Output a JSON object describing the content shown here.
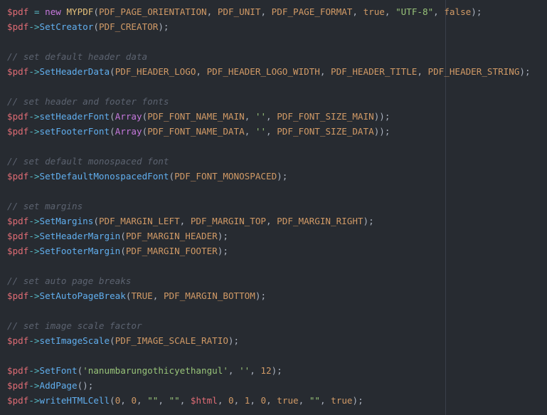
{
  "editor": {
    "lines": [
      [
        [
          "var",
          "$pdf"
        ],
        [
          "punc",
          " "
        ],
        [
          "op",
          "="
        ],
        [
          "punc",
          " "
        ],
        [
          "kw",
          "new"
        ],
        [
          "punc",
          " "
        ],
        [
          "cls",
          "MYPDF"
        ],
        [
          "punc",
          "("
        ],
        [
          "const",
          "PDF_PAGE_ORIENTATION"
        ],
        [
          "punc",
          ", "
        ],
        [
          "const",
          "PDF_UNIT"
        ],
        [
          "punc",
          ", "
        ],
        [
          "const",
          "PDF_PAGE_FORMAT"
        ],
        [
          "punc",
          ", "
        ],
        [
          "const",
          "true"
        ],
        [
          "punc",
          ", "
        ],
        [
          "str",
          "\"UTF-8\""
        ],
        [
          "punc",
          ", "
        ],
        [
          "const",
          "false"
        ],
        [
          "punc",
          ");"
        ]
      ],
      [
        [
          "var",
          "$pdf"
        ],
        [
          "op",
          "->"
        ],
        [
          "fn",
          "SetCreator"
        ],
        [
          "punc",
          "("
        ],
        [
          "const",
          "PDF_CREATOR"
        ],
        [
          "punc",
          ");"
        ]
      ],
      [],
      [
        [
          "cmt",
          "// set default header data"
        ]
      ],
      [
        [
          "var",
          "$pdf"
        ],
        [
          "op",
          "->"
        ],
        [
          "fn",
          "SetHeaderData"
        ],
        [
          "punc",
          "("
        ],
        [
          "const",
          "PDF_HEADER_LOGO"
        ],
        [
          "punc",
          ", "
        ],
        [
          "const",
          "PDF_HEADER_LOGO_WIDTH"
        ],
        [
          "punc",
          ", "
        ],
        [
          "const",
          "PDF_HEADER_TITLE"
        ],
        [
          "punc",
          ", "
        ],
        [
          "const",
          "PDF_HEADER_STRING"
        ],
        [
          "punc",
          ");"
        ]
      ],
      [],
      [
        [
          "cmt",
          "// set header and footer fonts"
        ]
      ],
      [
        [
          "var",
          "$pdf"
        ],
        [
          "op",
          "->"
        ],
        [
          "fn",
          "setHeaderFont"
        ],
        [
          "punc",
          "("
        ],
        [
          "kw",
          "Array"
        ],
        [
          "punc",
          "("
        ],
        [
          "const",
          "PDF_FONT_NAME_MAIN"
        ],
        [
          "punc",
          ", "
        ],
        [
          "str",
          "''"
        ],
        [
          "punc",
          ", "
        ],
        [
          "const",
          "PDF_FONT_SIZE_MAIN"
        ],
        [
          "punc",
          "));"
        ]
      ],
      [
        [
          "var",
          "$pdf"
        ],
        [
          "op",
          "->"
        ],
        [
          "fn",
          "setFooterFont"
        ],
        [
          "punc",
          "("
        ],
        [
          "kw",
          "Array"
        ],
        [
          "punc",
          "("
        ],
        [
          "const",
          "PDF_FONT_NAME_DATA"
        ],
        [
          "punc",
          ", "
        ],
        [
          "str",
          "''"
        ],
        [
          "punc",
          ", "
        ],
        [
          "const",
          "PDF_FONT_SIZE_DATA"
        ],
        [
          "punc",
          "));"
        ]
      ],
      [],
      [
        [
          "cmt",
          "// set default monospaced font"
        ]
      ],
      [
        [
          "var",
          "$pdf"
        ],
        [
          "op",
          "->"
        ],
        [
          "fn",
          "SetDefaultMonospacedFont"
        ],
        [
          "punc",
          "("
        ],
        [
          "const",
          "PDF_FONT_MONOSPACED"
        ],
        [
          "punc",
          ");"
        ]
      ],
      [],
      [
        [
          "cmt",
          "// set margins"
        ]
      ],
      [
        [
          "var",
          "$pdf"
        ],
        [
          "op",
          "->"
        ],
        [
          "fn",
          "SetMargins"
        ],
        [
          "punc",
          "("
        ],
        [
          "const",
          "PDF_MARGIN_LEFT"
        ],
        [
          "punc",
          ", "
        ],
        [
          "const",
          "PDF_MARGIN_TOP"
        ],
        [
          "punc",
          ", "
        ],
        [
          "const",
          "PDF_MARGIN_RIGHT"
        ],
        [
          "punc",
          ");"
        ]
      ],
      [
        [
          "var",
          "$pdf"
        ],
        [
          "op",
          "->"
        ],
        [
          "fn",
          "SetHeaderMargin"
        ],
        [
          "punc",
          "("
        ],
        [
          "const",
          "PDF_MARGIN_HEADER"
        ],
        [
          "punc",
          ");"
        ]
      ],
      [
        [
          "var",
          "$pdf"
        ],
        [
          "op",
          "->"
        ],
        [
          "fn",
          "SetFooterMargin"
        ],
        [
          "punc",
          "("
        ],
        [
          "const",
          "PDF_MARGIN_FOOTER"
        ],
        [
          "punc",
          ");"
        ]
      ],
      [],
      [
        [
          "cmt",
          "// set auto page breaks"
        ]
      ],
      [
        [
          "var",
          "$pdf"
        ],
        [
          "op",
          "->"
        ],
        [
          "fn",
          "SetAutoPageBreak"
        ],
        [
          "punc",
          "("
        ],
        [
          "const",
          "TRUE"
        ],
        [
          "punc",
          ", "
        ],
        [
          "const",
          "PDF_MARGIN_BOTTOM"
        ],
        [
          "punc",
          ");"
        ]
      ],
      [],
      [
        [
          "cmt",
          "// set image scale factor"
        ]
      ],
      [
        [
          "var",
          "$pdf"
        ],
        [
          "op",
          "->"
        ],
        [
          "fn",
          "setImageScale"
        ],
        [
          "punc",
          "("
        ],
        [
          "const",
          "PDF_IMAGE_SCALE_RATIO"
        ],
        [
          "punc",
          ");"
        ]
      ],
      [],
      [
        [
          "var",
          "$pdf"
        ],
        [
          "op",
          "->"
        ],
        [
          "fn",
          "SetFont"
        ],
        [
          "punc",
          "("
        ],
        [
          "str",
          "'nanumbarungothicyethangul'"
        ],
        [
          "punc",
          ", "
        ],
        [
          "str",
          "''"
        ],
        [
          "punc",
          ", "
        ],
        [
          "num",
          "12"
        ],
        [
          "punc",
          ");"
        ]
      ],
      [
        [
          "var",
          "$pdf"
        ],
        [
          "op",
          "->"
        ],
        [
          "fn",
          "AddPage"
        ],
        [
          "punc",
          "();"
        ]
      ],
      [
        [
          "var",
          "$pdf"
        ],
        [
          "op",
          "->"
        ],
        [
          "fn",
          "writeHTMLCell"
        ],
        [
          "punc",
          "("
        ],
        [
          "num",
          "0"
        ],
        [
          "punc",
          ", "
        ],
        [
          "num",
          "0"
        ],
        [
          "punc",
          ", "
        ],
        [
          "str",
          "\"\""
        ],
        [
          "punc",
          ", "
        ],
        [
          "str",
          "\"\""
        ],
        [
          "punc",
          ", "
        ],
        [
          "var",
          "$html"
        ],
        [
          "punc",
          ", "
        ],
        [
          "num",
          "0"
        ],
        [
          "punc",
          ", "
        ],
        [
          "num",
          "1"
        ],
        [
          "punc",
          ", "
        ],
        [
          "num",
          "0"
        ],
        [
          "punc",
          ", "
        ],
        [
          "const",
          "true"
        ],
        [
          "punc",
          ", "
        ],
        [
          "str",
          "\"\""
        ],
        [
          "punc",
          ", "
        ],
        [
          "const",
          "true"
        ],
        [
          "punc",
          ");"
        ]
      ]
    ]
  }
}
